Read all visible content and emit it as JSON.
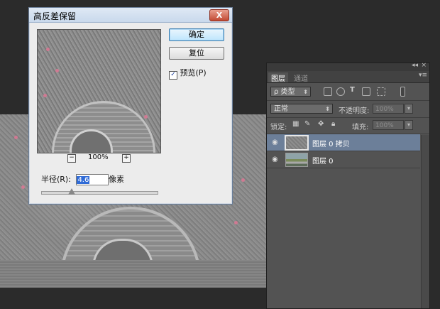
{
  "dialog": {
    "title": "高反差保留",
    "close_label": "X",
    "ok_label": "确定",
    "reset_label": "复位",
    "preview_label": "预览(P)",
    "preview_checked": true,
    "zoom_minus": "−",
    "zoom_plus": "+",
    "zoom_value": "100%",
    "radius_label": "半径(R):",
    "radius_value": "4.6",
    "radius_unit": "像素",
    "slider_fraction": 0.26
  },
  "panel": {
    "collapse_icon": "◂◂",
    "close_icon": "×",
    "tabs": [
      "图层",
      "通道"
    ],
    "menu_icon": "▾≡",
    "filter_kind": "ρ 类型",
    "filter_arrow": "⬍",
    "blend_mode": "正常",
    "opacity_label": "不透明度:",
    "opacity_value": "100%",
    "lock_label": "锁定:",
    "fill_label": "填充:",
    "fill_value": "100%",
    "stepper_arrow": "▾",
    "layers": [
      {
        "name": "图层 0 拷贝",
        "selected": true
      },
      {
        "name": "图层 0",
        "selected": false
      }
    ],
    "eye_icon": "◉"
  },
  "colors": {
    "background": "#2b2b2b",
    "panel": "#535353",
    "selected_layer": "#6c7f99",
    "dialog": "#ececec"
  }
}
